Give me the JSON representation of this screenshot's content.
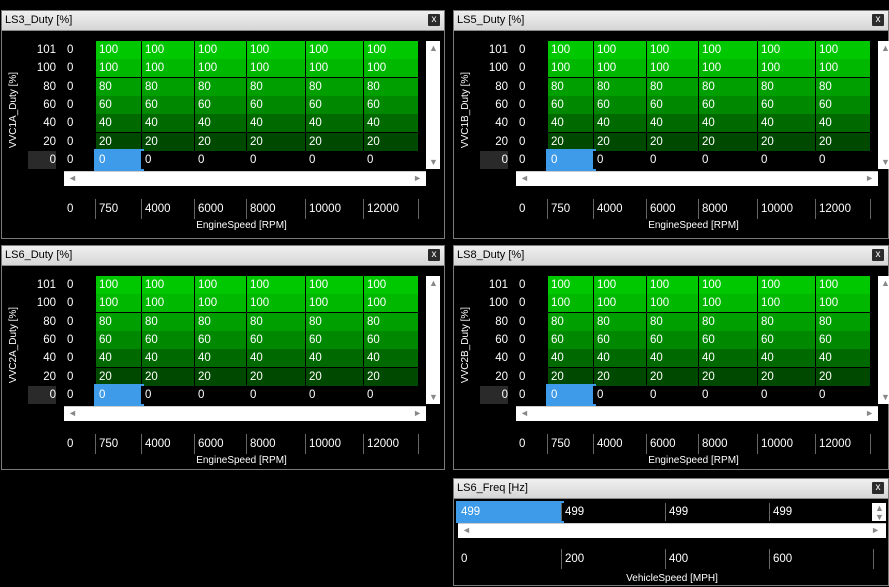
{
  "colors": {
    "row101": "#00c800",
    "row100": "#00b800",
    "row80": "#009f00",
    "row60": "#008800",
    "row40": "#006900",
    "row20": "#004900",
    "row0": "#000000",
    "selection": "#3d9be9"
  },
  "icons": {
    "close": "close-icon",
    "left_arrow": "arrow-left-icon",
    "right_arrow": "arrow-right-icon",
    "up_arrow": "arrow-up-icon",
    "down_arrow": "arrow-down-icon"
  },
  "close_glyph": "x",
  "panels": [
    {
      "title": "LS3_Duty [%]",
      "ylabel": "VVC1A_Duty [%]",
      "xlabel": "EngineSpeed [RPM]"
    },
    {
      "title": "LS5_Duty [%]",
      "ylabel": "VVC1B_Duty [%]",
      "xlabel": "EngineSpeed [RPM]"
    },
    {
      "title": "LS6_Duty [%]",
      "ylabel": "VVC2A_Duty [%]",
      "xlabel": "EngineSpeed [RPM]"
    },
    {
      "title": "LS8_Duty [%]",
      "ylabel": "VVC2B_Duty [%]",
      "xlabel": "EngineSpeed [RPM]"
    }
  ],
  "table": {
    "row_headers": [
      "101",
      "100",
      "80",
      "60",
      "40",
      "20",
      "0"
    ],
    "x_axis": [
      "0",
      "750",
      "4000",
      "6000",
      "8000",
      "10000",
      "12000"
    ],
    "rows": [
      [
        "0",
        "100",
        "100",
        "100",
        "100",
        "100",
        "100"
      ],
      [
        "0",
        "100",
        "100",
        "100",
        "100",
        "100",
        "100"
      ],
      [
        "0",
        "80",
        "80",
        "80",
        "80",
        "80",
        "80"
      ],
      [
        "0",
        "60",
        "60",
        "60",
        "60",
        "60",
        "60"
      ],
      [
        "0",
        "40",
        "40",
        "40",
        "40",
        "40",
        "40"
      ],
      [
        "0",
        "20",
        "20",
        "20",
        "20",
        "20",
        "20"
      ],
      [
        "0",
        "0",
        "0",
        "0",
        "0",
        "0",
        "0"
      ]
    ]
  },
  "freq_panel": {
    "title": "LS6_Freq [Hz]",
    "values": [
      "499",
      "499",
      "499",
      "499"
    ],
    "x_axis": [
      "0",
      "200",
      "400",
      "600"
    ],
    "xlabel": "VehicleSpeed [MPH]"
  }
}
